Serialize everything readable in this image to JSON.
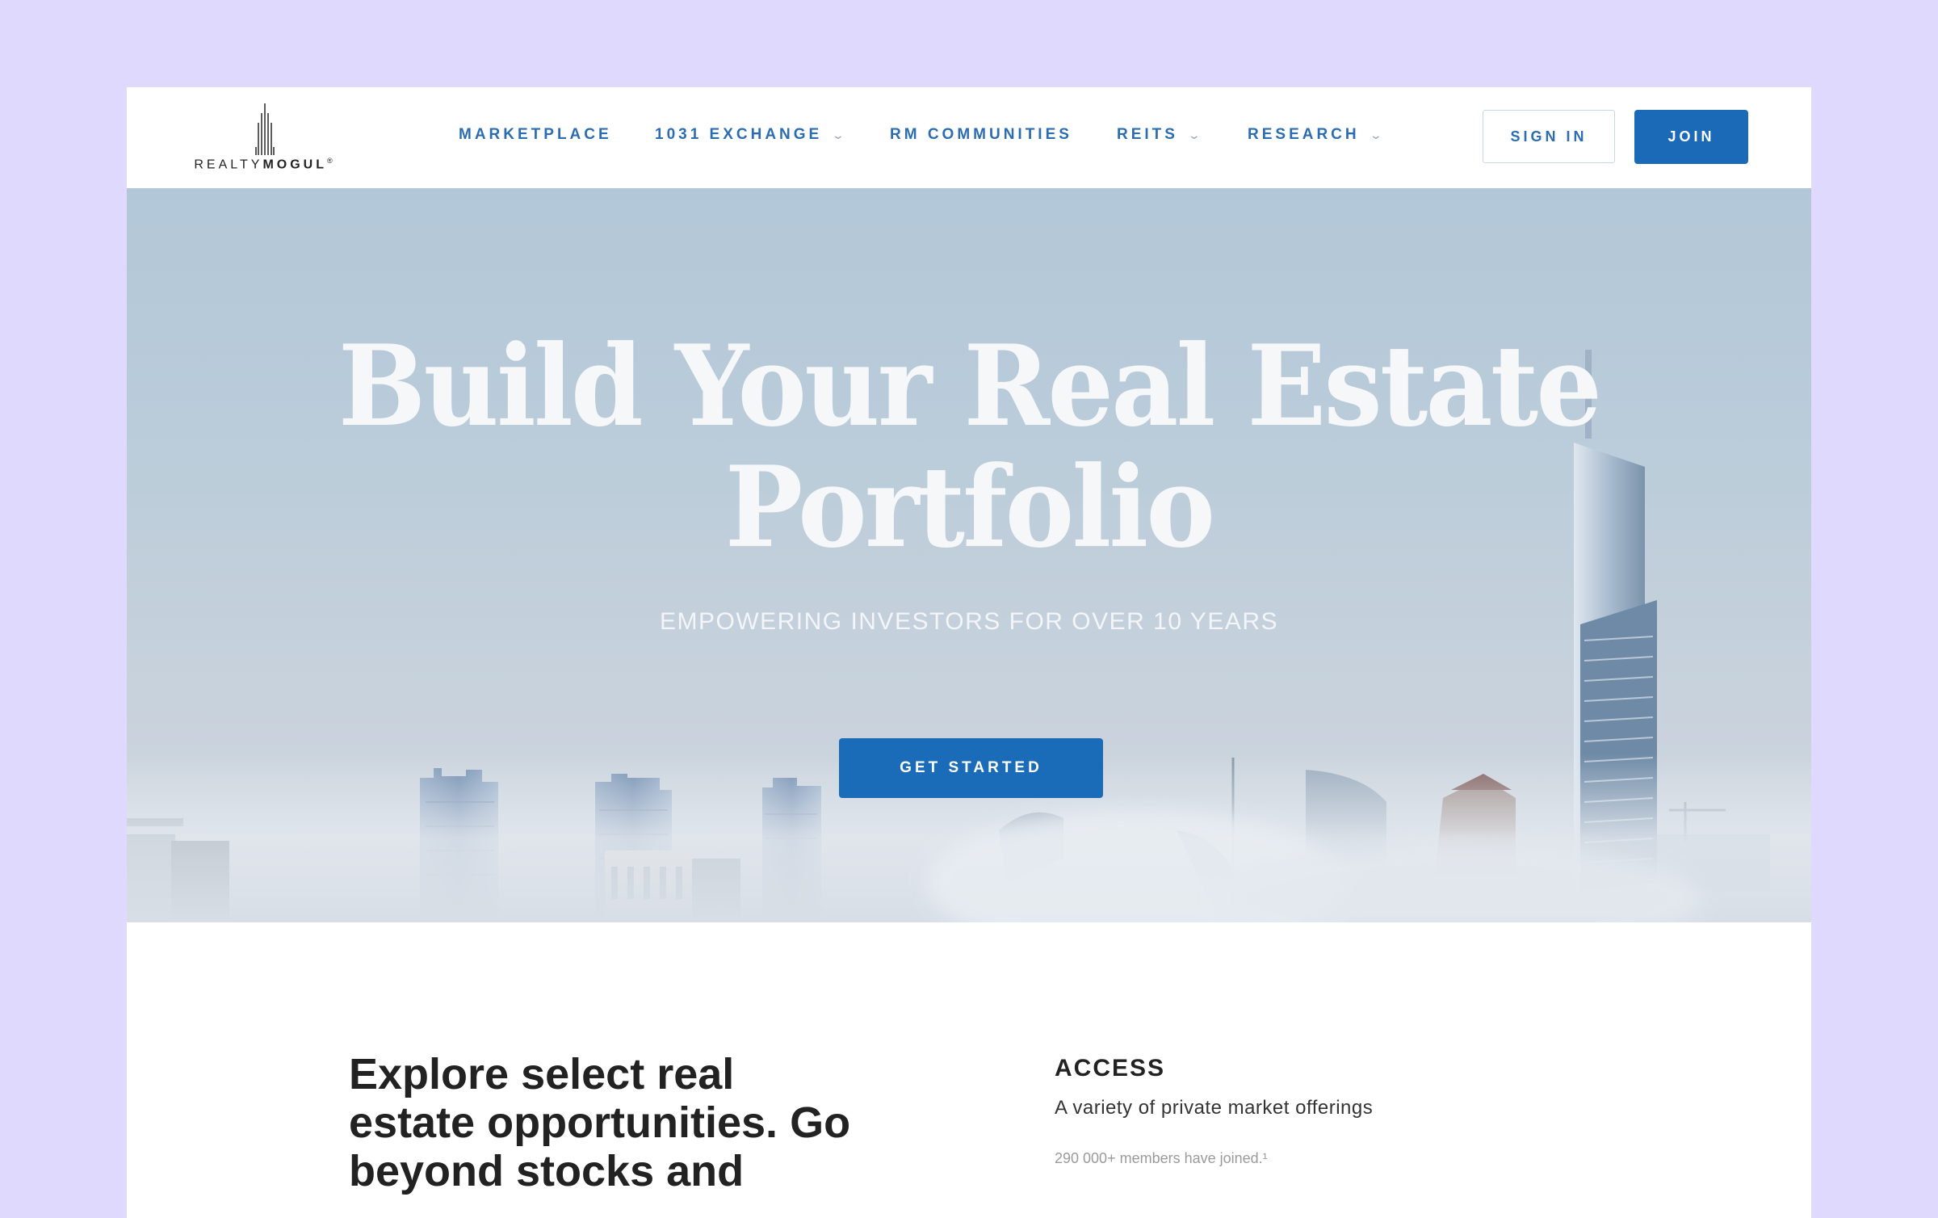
{
  "brand": {
    "name_light": "REALTY",
    "name_bold": "MOGUL",
    "mark": "®"
  },
  "nav": {
    "items": [
      {
        "label": "MARKETPLACE",
        "has_dropdown": false
      },
      {
        "label": "1031 EXCHANGE",
        "has_dropdown": true
      },
      {
        "label": "RM COMMUNITIES",
        "has_dropdown": false
      },
      {
        "label": "REITS",
        "has_dropdown": true
      },
      {
        "label": "RESEARCH",
        "has_dropdown": true
      }
    ],
    "chevron": "⌄",
    "sign_in": "SIGN IN",
    "join": "JOIN"
  },
  "hero": {
    "title_line1": "Build Your Real Estate",
    "title_line2": "Portfolio",
    "subtitle": "EMPOWERING INVESTORS FOR OVER 10 YEARS",
    "cta": "GET STARTED"
  },
  "intro": {
    "headline": "Explore select real estate opportunities. Go beyond stocks and",
    "access": {
      "title": "ACCESS",
      "description": "A variety of private market offerings",
      "note": "290 000+ members have joined.¹"
    }
  },
  "colors": {
    "page_bg": "#dfd9fe",
    "brand_blue": "#1b6ab8",
    "nav_text": "#2b6cb3"
  }
}
